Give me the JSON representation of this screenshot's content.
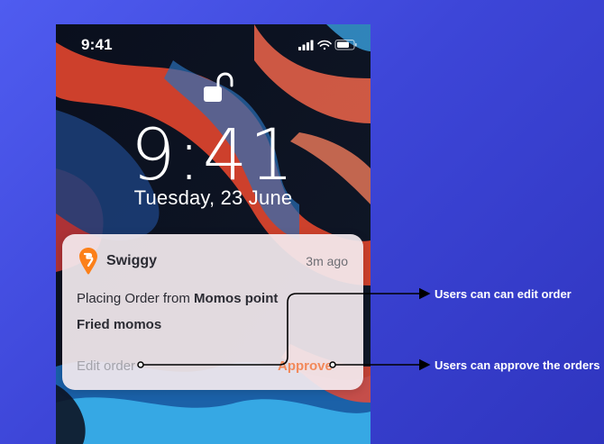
{
  "status_bar": {
    "time": "9:41"
  },
  "lock_screen": {
    "clock": "9:41",
    "date": "Tuesday, 23 June"
  },
  "notification": {
    "app_name": "Swiggy",
    "timestamp": "3m ago",
    "message_prefix": "Placing Order from",
    "restaurant": "Momos point",
    "item": "Fried momos",
    "actions": {
      "edit_label": "Edit order",
      "approve_label": "Approve"
    },
    "colors": {
      "brand": "#fc8019",
      "approve": "#f2895a"
    }
  },
  "annotations": [
    {
      "label": "Users can can edit order"
    },
    {
      "label": "Users can approve the orders"
    }
  ],
  "icons": [
    "signal-icon",
    "wifi-icon",
    "battery-icon",
    "unlock-icon",
    "swiggy-logo-icon"
  ]
}
